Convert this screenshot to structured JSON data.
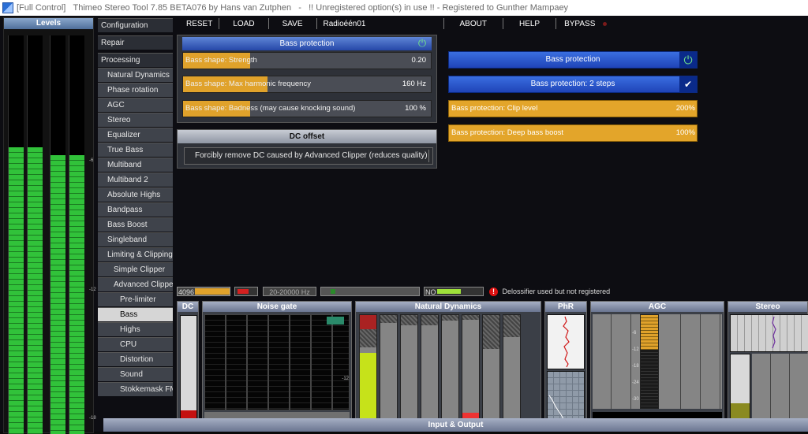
{
  "titlebar": {
    "mode": "[Full Control]",
    "title": "Thimeo Stereo Tool 7.85 BETA076 by Hans van Zutphen",
    "warning": "!! Unregistered option(s) in use !! - Registered to Gunther Mampaey"
  },
  "levels": {
    "title": "Levels",
    "fill_fractions": [
      0.72,
      0.72,
      0.7,
      0.7
    ],
    "ticks": [
      "-6",
      "-12",
      "-18"
    ]
  },
  "sidebar": {
    "items": [
      {
        "label": "Configuration",
        "level": 0
      },
      {
        "label": "Repair",
        "level": 0
      },
      {
        "label": "Processing",
        "level": 0
      },
      {
        "label": "Natural Dynamics",
        "level": 1
      },
      {
        "label": "Phase rotation",
        "level": 1
      },
      {
        "label": "AGC",
        "level": 1
      },
      {
        "label": "Stereo",
        "level": 1
      },
      {
        "label": "Equalizer",
        "level": 1
      },
      {
        "label": "True Bass",
        "level": 1
      },
      {
        "label": "Multiband",
        "level": 1
      },
      {
        "label": "Multiband 2",
        "level": 1
      },
      {
        "label": "Absolute Highs",
        "level": 1
      },
      {
        "label": "Bandpass",
        "level": 1
      },
      {
        "label": "Bass Boost",
        "level": 1
      },
      {
        "label": "Singleband",
        "level": 1
      },
      {
        "label": "Limiting & Clipping",
        "level": 1
      },
      {
        "label": "Simple Clipper",
        "level": 2
      },
      {
        "label": "Advanced Clipper",
        "level": 2
      },
      {
        "label": "Pre-limiter",
        "level": 3
      },
      {
        "label": "Bass",
        "level": 3,
        "active": true
      },
      {
        "label": "Highs",
        "level": 3
      },
      {
        "label": "CPU",
        "level": 3
      },
      {
        "label": "Distortion",
        "level": 3
      },
      {
        "label": "Sound",
        "level": 3
      },
      {
        "label": "Stokkemask FM",
        "level": 3
      }
    ]
  },
  "toolbar": {
    "reset": "RESET",
    "load": "LOAD",
    "save": "SAVE",
    "preset": "Radioéén01",
    "about": "ABOUT",
    "help": "HELP",
    "bypass": "BYPASS"
  },
  "bass_panel": {
    "title": "Bass protection",
    "sliders": [
      {
        "label": "Bass shape: Strength",
        "value": "0.20",
        "fill": 0.27
      },
      {
        "label": "Bass shape: Max harmonic frequency",
        "value": "160 Hz",
        "fill": 0.34
      },
      {
        "label": "Bass shape: Badness (may cause knocking sound)",
        "value": "100 %",
        "fill": 0.27
      }
    ]
  },
  "dc_panel": {
    "title": "DC offset",
    "option": "Forcibly remove DC caused by Advanced Clipper (reduces quality)"
  },
  "right_panel": {
    "bass_protection": "Bass protection",
    "bass_steps": "Bass protection: 2 steps",
    "clip_level_label": "Bass protection: Clip level",
    "clip_level_value": "200%",
    "deep_bass_label": "Bass protection: Deep bass boost",
    "deep_bass_value": "100%"
  },
  "status": {
    "buffer": "4096",
    "freq": "20-20000 Hz",
    "no_label": "NO",
    "notice": "Delossifier used but not registered"
  },
  "modules": {
    "dc": "DC",
    "noise_gate": "Noise gate",
    "natural_dynamics": "Natural Dynamics",
    "phr": "PhR",
    "agc": "AGC",
    "stereo": "Stereo",
    "agc_ticks": [
      "-6",
      "-12",
      "-18",
      "-24",
      "-30"
    ]
  },
  "bottombar": {
    "title": "Input & Output"
  },
  "colors": {
    "accent_blue": "#2547a8",
    "slider_orange": "#e0a22b",
    "meter_green": "#31c23a"
  }
}
